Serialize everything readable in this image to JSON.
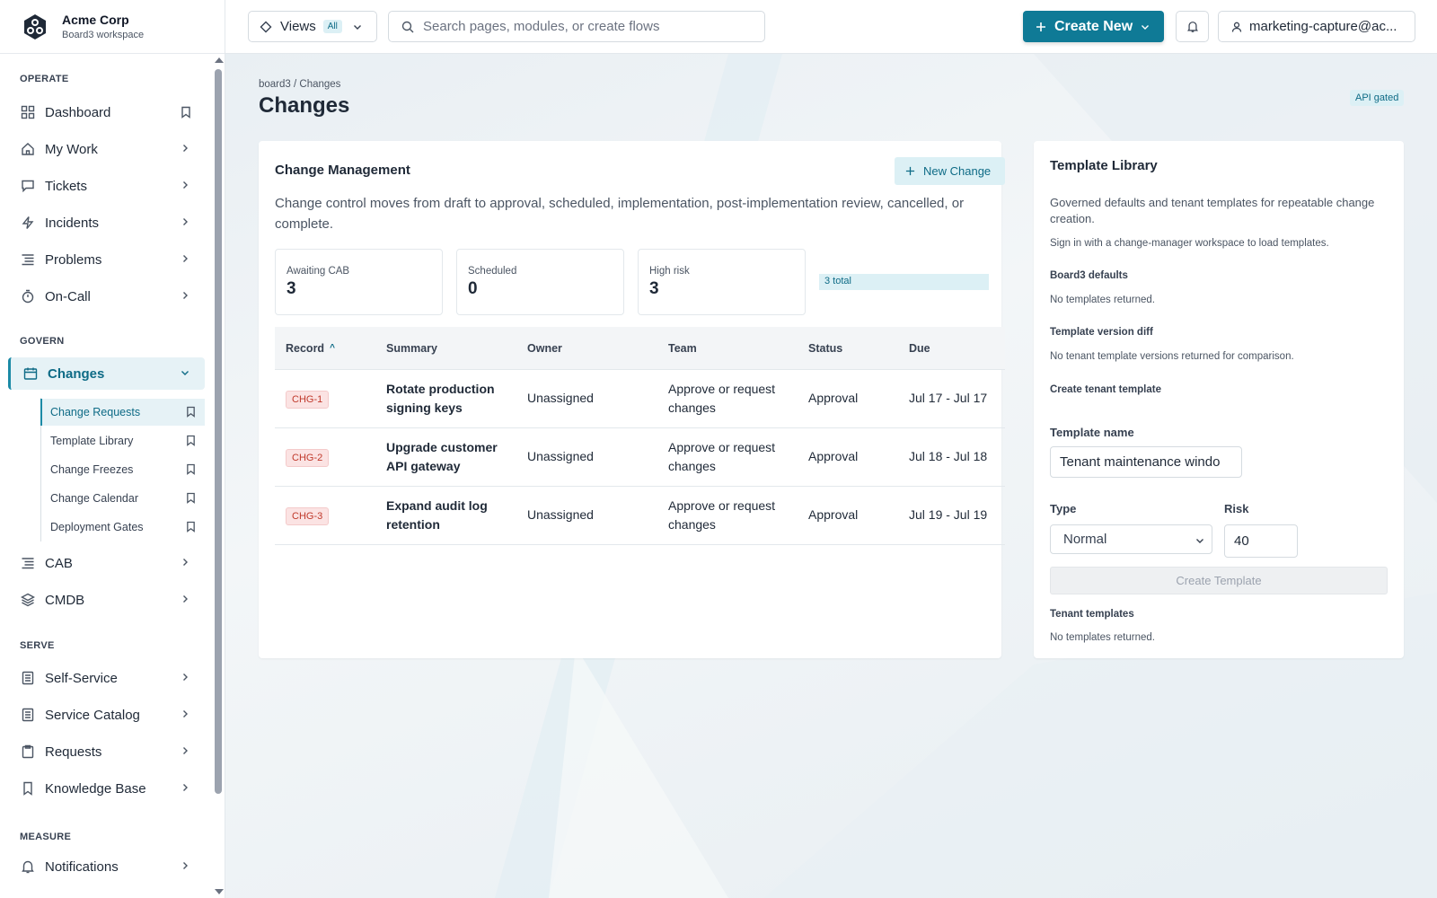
{
  "brand": {
    "name": "Acme Corp",
    "workspace": "Board3 workspace"
  },
  "nav": {
    "operate_title": "OPERATE",
    "govern_title": "GOVERN",
    "serve_title": "SERVE",
    "measure_title": "MEASURE",
    "items": {
      "dashboard": "Dashboard",
      "my_work": "My Work",
      "tickets": "Tickets",
      "incidents": "Incidents",
      "problems": "Problems",
      "on_call": "On-Call",
      "changes": "Changes",
      "cab": "CAB",
      "cmdb": "CMDB",
      "self_service": "Self-Service",
      "service_catalog": "Service Catalog",
      "requests": "Requests",
      "knowledge_base": "Knowledge Base",
      "notifications": "Notifications"
    },
    "sub_items": {
      "change_requests": "Change Requests",
      "template_library": "Template Library",
      "change_freezes": "Change Freezes",
      "change_calendar": "Change Calendar",
      "deployment_gates": "Deployment Gates"
    }
  },
  "topbar": {
    "views_label": "Views",
    "views_badge": "All",
    "search_placeholder": "Search pages, modules, or create flows",
    "create_label": "Create New",
    "user_label": "marketing-capture@ac..."
  },
  "page": {
    "breadcrumb": "board3 / Changes",
    "title": "Changes",
    "api_badge": "API gated"
  },
  "change_management": {
    "title": "Change Management",
    "new_button": "New Change",
    "description": "Change control moves from draft to approval, scheduled, implementation, post-implementation review, cancelled, or complete.",
    "stats": [
      {
        "label": "Awaiting CAB",
        "value": "3"
      },
      {
        "label": "Scheduled",
        "value": "0"
      },
      {
        "label": "High risk",
        "value": "3"
      }
    ],
    "total_badge": "3 total",
    "columns": {
      "record": "Record",
      "summary": "Summary",
      "owner": "Owner",
      "team": "Team",
      "status": "Status",
      "due": "Due"
    },
    "sort_indicator": "^",
    "rows": [
      {
        "record": "CHG-1",
        "summary": "Rotate production signing keys",
        "owner": "Unassigned",
        "team": "Approve or request changes",
        "status": "Approval",
        "due": "Jul 17 - Jul 17"
      },
      {
        "record": "CHG-2",
        "summary": "Upgrade customer API gateway",
        "owner": "Unassigned",
        "team": "Approve or request changes",
        "status": "Approval",
        "due": "Jul 18 - Jul 18"
      },
      {
        "record": "CHG-3",
        "summary": "Expand audit log retention",
        "owner": "Unassigned",
        "team": "Approve or request changes",
        "status": "Approval",
        "due": "Jul 19 - Jul 19"
      }
    ]
  },
  "template_library": {
    "title": "Template Library",
    "description": "Governed defaults and tenant templates for repeatable change creation.",
    "sign_in_note": "Sign in with a change-manager workspace to load templates.",
    "board3_defaults_title": "Board3 defaults",
    "board3_defaults_empty": "No templates returned.",
    "version_diff_title": "Template version diff",
    "version_diff_empty": "No tenant template versions returned for comparison.",
    "create_title": "Create tenant template",
    "name_label": "Template name",
    "name_value": "Tenant maintenance windo",
    "type_label": "Type",
    "type_value": "Normal",
    "risk_label": "Risk",
    "risk_value": "40",
    "create_button": "Create Template",
    "tenant_title": "Tenant templates",
    "tenant_empty": "No templates returned."
  },
  "colors": {
    "accent": "#0f7a96",
    "accent_light": "#dcf0f5",
    "danger": "#c0392b"
  }
}
